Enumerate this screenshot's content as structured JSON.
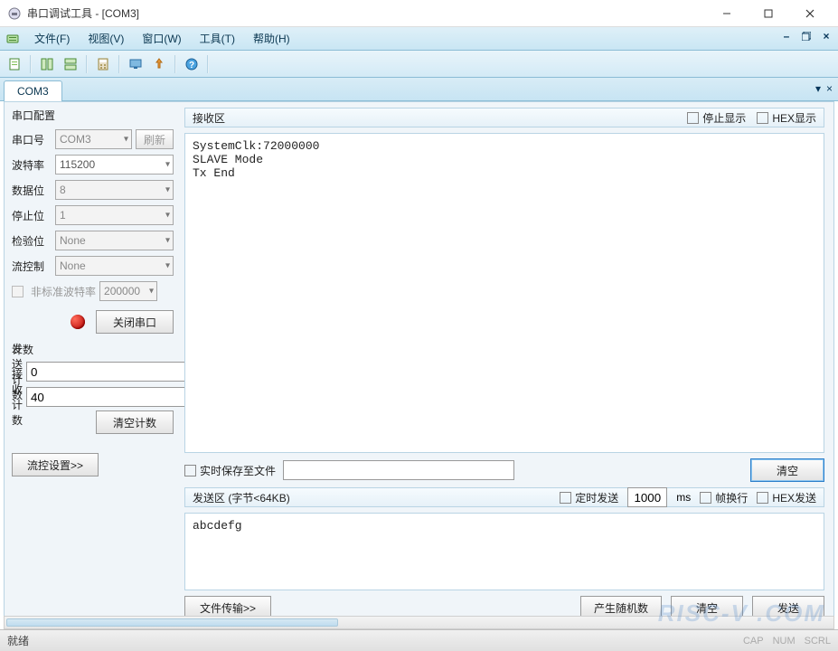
{
  "window": {
    "title": "串口调试工具 - [COM3]"
  },
  "menu": {
    "file": "文件(F)",
    "view": "视图(V)",
    "window": "窗口(W)",
    "tools": "工具(T)",
    "help": "帮助(H)"
  },
  "tabs": {
    "active": "COM3"
  },
  "config": {
    "title": "串口配置",
    "port_label": "串口号",
    "port_value": "COM3",
    "refresh": "刷新",
    "baud_label": "波特率",
    "baud_value": "115200",
    "databits_label": "数据位",
    "databits_value": "8",
    "stopbits_label": "停止位",
    "stopbits_value": "1",
    "parity_label": "检验位",
    "parity_value": "None",
    "flow_label": "流控制",
    "flow_value": "None",
    "nonstd_label": "非标准波特率",
    "nonstd_value": "200000",
    "close_port": "关闭串口"
  },
  "counters": {
    "title": "计数",
    "send_label": "发送计数",
    "send_value": "0",
    "recv_label": "接收计数",
    "recv_value": "40",
    "clear": "清空计数"
  },
  "flow_settings_btn": "流控设置>>",
  "recv": {
    "title": "接收区",
    "stop_display": "停止显示",
    "hex_display": "HEX显示",
    "content": "SystemClk:72000000\nSLAVE Mode\nTx End"
  },
  "save_file": {
    "label": "实时保存至文件",
    "clear": "清空"
  },
  "send": {
    "title": "发送区 (字节<64KB)",
    "timed_label": "定时发送",
    "timed_value": "1000",
    "timed_unit": "ms",
    "wrap_label": "帧换行",
    "hex_label": "HEX发送",
    "content": "abcdefg"
  },
  "actions": {
    "file_transfer": "文件传输>>",
    "random": "产生随机数",
    "clear": "清空",
    "send": "发送"
  },
  "status": {
    "ready": "就绪",
    "cap": "CAP",
    "num": "NUM",
    "scrl": "SCRL"
  },
  "watermark": "RISC-V .COM"
}
